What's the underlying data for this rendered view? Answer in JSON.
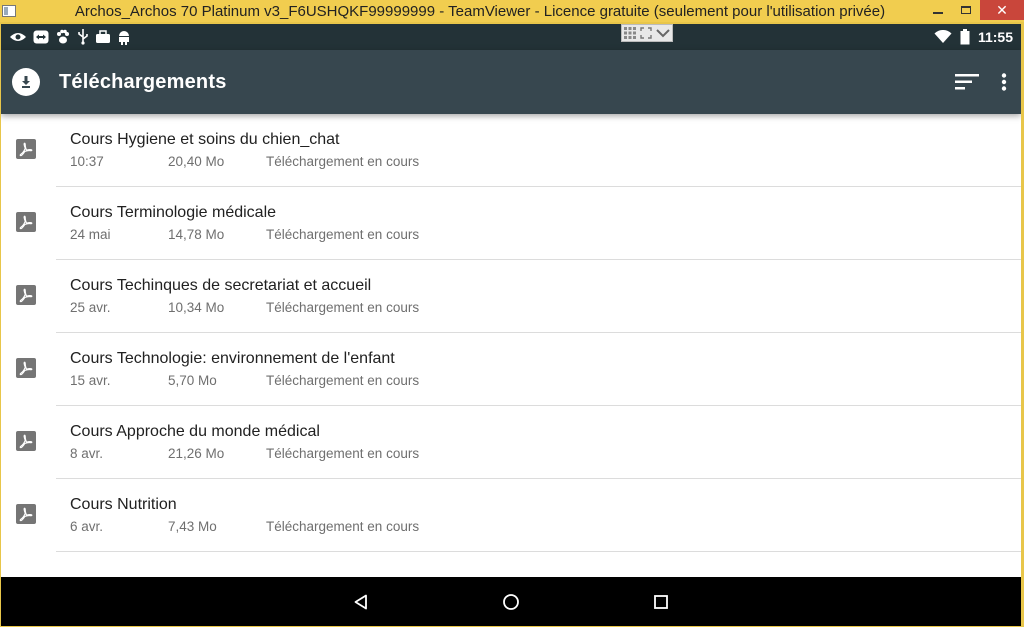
{
  "window": {
    "title": "Archos_Archos 70 Platinum v3_F6USHQKF99999999 - TeamViewer - Licence gratuite (seulement pour l'utilisation privée)",
    "close_label": "✕"
  },
  "status_bar": {
    "left_icons": [
      "eye-icon",
      "teamviewer-icon",
      "paw-icon",
      "usb-icon",
      "briefcase-icon",
      "android-icon"
    ],
    "time": "11:55"
  },
  "app_bar": {
    "title": "Téléchargements",
    "actions": [
      "sort-icon",
      "more-vert-icon"
    ]
  },
  "downloads": [
    {
      "name": "Cours Hygiene et soins du chien_chat",
      "date": "10:37",
      "size": "20,40 Mo",
      "status": "Téléchargement en cours"
    },
    {
      "name": "Cours Terminologie médicale",
      "date": "24 mai",
      "size": "14,78 Mo",
      "status": "Téléchargement en cours"
    },
    {
      "name": "Cours Techinques de secretariat et accueil",
      "date": "25 avr.",
      "size": "10,34 Mo",
      "status": "Téléchargement en cours"
    },
    {
      "name": "Cours Technologie: environnement de l'enfant",
      "date": "15 avr.",
      "size": "5,70 Mo",
      "status": "Téléchargement en cours"
    },
    {
      "name": "Cours Approche du monde médical",
      "date": "8 avr.",
      "size": "21,26 Mo",
      "status": "Téléchargement en cours"
    },
    {
      "name": "Cours Nutrition",
      "date": "6 avr.",
      "size": "7,43 Mo",
      "status": "Téléchargement en cours"
    }
  ],
  "colors": {
    "app_bar": "#37474f",
    "status_bar": "#233237",
    "window_title": "#f1cd4f",
    "close": "#c9463b"
  }
}
